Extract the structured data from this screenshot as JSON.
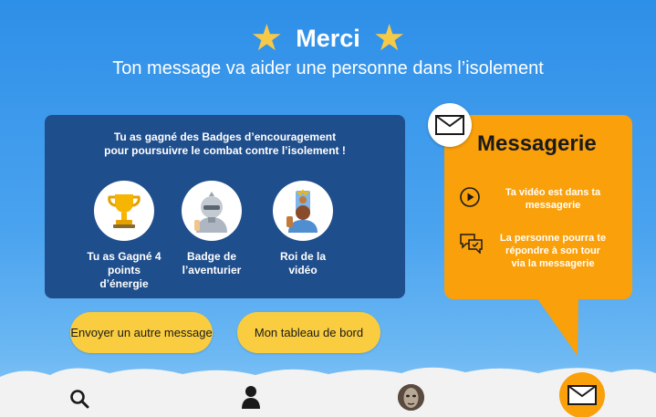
{
  "header": {
    "title": "Merci",
    "subtitle": "Ton message va aider une personne dans l’isolement"
  },
  "badges": {
    "intro_line1": "Tu as gagné des Badges d’encouragement",
    "intro_line2": "pour poursuivre  le combat contre l’isolement !",
    "items": [
      {
        "icon": "trophy-icon",
        "line1": "Tu as Gagné 4 points",
        "line2": "d’énergie"
      },
      {
        "icon": "knight-icon",
        "line1": "Badge de",
        "line2": "l’aventurier"
      },
      {
        "icon": "king-video-icon",
        "line1": "Roi de la",
        "line2": "vidéo"
      }
    ]
  },
  "messagerie": {
    "title": "Messagerie",
    "row1_line1": "Ta vidéo est dans ta",
    "row1_line2": "messagerie",
    "row2_line1": "La personne pourra te",
    "row2_line2": "répondre à son tour",
    "row2_line3": "via la messagerie"
  },
  "buttons": {
    "send_another": "Envoyer un autre message",
    "dashboard": "Mon tableau de bord"
  },
  "nav": {
    "items": [
      "search-icon",
      "user-icon",
      "avatar",
      "mail-icon"
    ],
    "active": "mail-icon"
  },
  "colors": {
    "sky": "#2e8fe8",
    "panel_blue": "#1f4e8c",
    "orange": "#f9a00a",
    "button_yellow": "#f9cd3f",
    "star": "#f7c948",
    "nav_bg": "#f2f2f2"
  }
}
